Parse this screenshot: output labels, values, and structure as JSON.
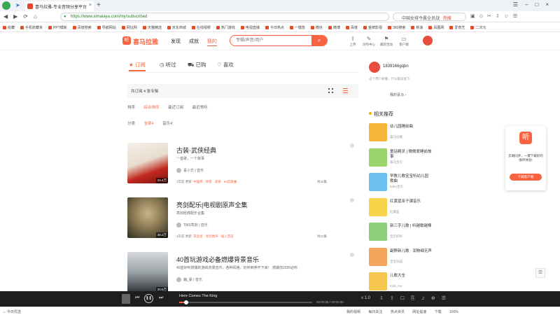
{
  "browser": {
    "tab_title": "喜马拉雅-专业音频分享平台",
    "url": "https://www.ximalaya.com/my/subscribed",
    "search_text": "中国女排今晨全员战",
    "search_badge": "热搜",
    "bookmarks": [
      "收藏",
      "手机收藏夹",
      "PPT模板",
      "百度搜索",
      "导航网站",
      "网址网",
      "天猫精选",
      "京东商城",
      "在线视频",
      "热门游戏",
      "电视直播",
      "今日热点",
      "一键放",
      "微信",
      "微博",
      "百度",
      "金牌影视",
      "360搜索",
      "新浪",
      "凤凰网",
      "爱奇艺",
      "二次元"
    ]
  },
  "site": {
    "logo_text": "喜马拉雅",
    "nav": [
      "发现",
      "成就",
      "我的"
    ],
    "search_placeholder": "专辑/声音/用户",
    "header_icons": [
      "上传",
      "创作中心",
      "最新活动",
      "客户端"
    ]
  },
  "content_tabs": [
    "订阅",
    "听过",
    "已购",
    "喜欢"
  ],
  "summary": "共订阅 4 张专辑",
  "sort": {
    "label": "排序",
    "options": [
      "综合排序",
      "最近订阅",
      "最近常听"
    ]
  },
  "filter": {
    "label": "分类",
    "options": [
      "全部4",
      "音乐4"
    ]
  },
  "albums": [
    {
      "title": "古装·武侠经典",
      "desc": "一首歌，一个故事",
      "author": "喜小方",
      "category": "音乐",
      "meta_prefix": "1年前 更新:",
      "meta_tags": "中国风 · 侠客 · 武侠 · 54首歌曲",
      "plays": "24.4万",
      "count": "共32集"
    },
    {
      "title": "亮剑配乐|电视剧原声全集",
      "desc": "亮剑经典配乐合集",
      "author": "TMS亮剑",
      "category": "音乐",
      "meta_prefix": "1年前 更新:",
      "meta_tags": "李云龙 · 亮剑原声 · 插入音乐",
      "plays": "38.2万",
      "count": "共21集"
    },
    {
      "title": "40首玩游戏必备燃爆背景音乐",
      "desc": "40首好听燃爆的游戏背景音乐，各种风格，好听到停不下来！ 燃爆你2020必听",
      "author": "巍_豪",
      "category": "音乐",
      "meta_prefix": "",
      "meta_tags": "",
      "plays": "20.6万",
      "count": ""
    }
  ],
  "user": {
    "name": "1839166gqbn",
    "sub": "这个用户很懒，什么都没留下",
    "link": "我的喜马 ›"
  },
  "rec_header": "相关推荐",
  "recs": [
    {
      "title": "幼儿园睡前曲",
      "sub": "喜马拉雅"
    },
    {
      "title": "童话精灵 | 微微爱睡前故事",
      "sub": "喜马宝贝"
    },
    {
      "title": "早教儿歌宝宝听幼儿园歌曲",
      "sub": "bobo宝贝"
    },
    {
      "title": "红黄蓝亲子课音乐",
      "sub": "红黄蓝"
    },
    {
      "title": "新三字儿歌 | 听越歌越棒",
      "sub": "宝贝好听"
    },
    {
      "title": "副野新儿歌 · 润物细无声",
      "sub": "宝宝乐园"
    },
    {
      "title": "儿歌大全",
      "sub": "Kids_me"
    }
  ],
  "promo": {
    "text": "云端同步，一键下载好的收听体验!",
    "button": "下载客户端"
  },
  "player": {
    "title": "Here Comes The King",
    "time": "00:00:06 / 00:01:00",
    "speed": "x 1.0",
    "progress": 0.05
  },
  "statusbar": {
    "left": "今日优选",
    "right": [
      "我的视频",
      "每日关注",
      "热点资讯",
      "网址提速",
      "下载"
    ],
    "zoom": "100%"
  },
  "colors": {
    "accent": "#f86442",
    "player_bg": "#1e1e1e"
  }
}
